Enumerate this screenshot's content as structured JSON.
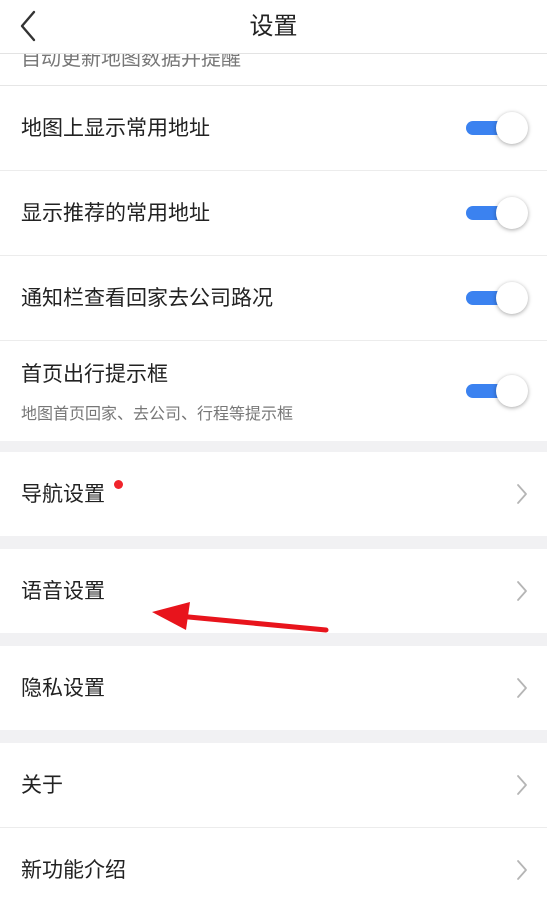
{
  "header": {
    "title": "设置",
    "back_icon": "chevron-left-icon"
  },
  "partial_row": {
    "text": "自动更新地图数据并提醒"
  },
  "toggle_rows": [
    {
      "label": "地图上显示常用地址",
      "on": true
    },
    {
      "label": "显示推荐的常用地址",
      "on": true
    },
    {
      "label": "通知栏查看回家去公司路况",
      "on": true
    },
    {
      "label": "首页出行提示框",
      "sub": "地图首页回家、去公司、行程等提示框",
      "on": true
    }
  ],
  "nav_rows": {
    "navigation": {
      "label": "导航设置",
      "badge": "red-dot"
    },
    "voice": {
      "label": "语音设置"
    },
    "privacy": {
      "label": "隐私设置"
    },
    "about": {
      "label": "关于"
    },
    "new_features": {
      "label": "新功能介绍"
    }
  },
  "colors": {
    "accent": "#3b82f0",
    "badge": "#f0242c",
    "annotation": "#e8141c",
    "background": "#f1f1f3"
  }
}
